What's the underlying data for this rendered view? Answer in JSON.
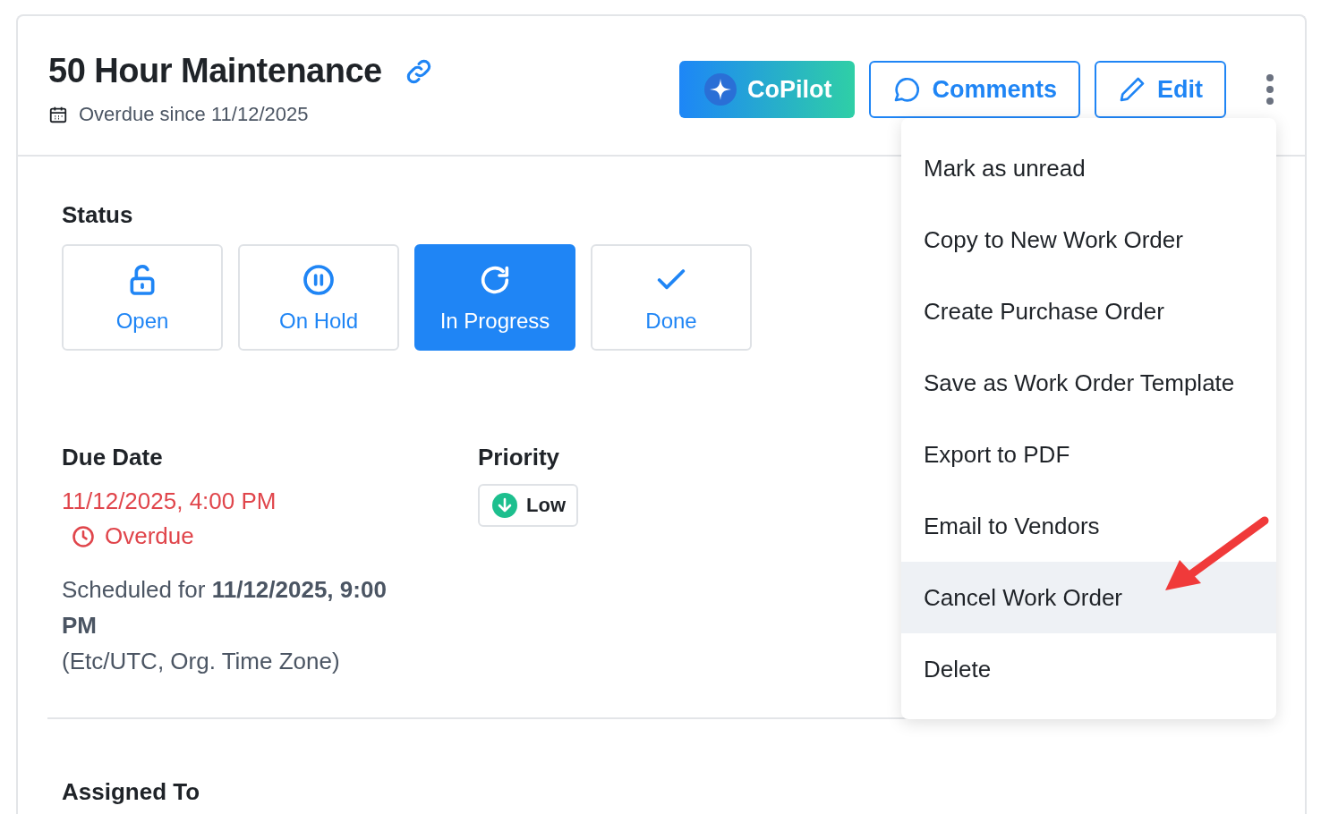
{
  "header": {
    "title": "50 Hour Maintenance",
    "subtitle": "Overdue since 11/12/2025",
    "buttons": [
      {
        "label": "CoPilot",
        "kind": "copilot"
      },
      {
        "label": "Comments",
        "kind": "comments"
      },
      {
        "label": "Edit",
        "kind": "edit"
      }
    ]
  },
  "status": {
    "label": "Status",
    "options": [
      {
        "label": "Open",
        "kind": "open",
        "selected": false
      },
      {
        "label": "On Hold",
        "kind": "hold",
        "selected": false
      },
      {
        "label": "In Progress",
        "kind": "progress",
        "selected": true
      },
      {
        "label": "Done",
        "kind": "done",
        "selected": false
      }
    ]
  },
  "due_date": {
    "label": "Due Date",
    "value": "11/12/2025, 4:00 PM",
    "overdue": "Overdue",
    "scheduled": "Scheduled for **11/12/2025, 9:00 PM**",
    "timezone": "(Etc/UTC, Org. Time Zone)"
  },
  "priority": {
    "label": "Priority",
    "value": "Low",
    "kind": "low"
  },
  "menu": [
    {
      "label": "Mark as unread",
      "selected": false
    },
    {
      "label": "Copy to New Work Order",
      "selected": false
    },
    {
      "label": "Create Purchase Order",
      "selected": false
    },
    {
      "label": "Save as Work Order Template",
      "selected": false
    },
    {
      "label": "Export to PDF",
      "selected": false
    },
    {
      "label": "Email to Vendors",
      "selected": false
    },
    {
      "label": "Cancel Work Order",
      "selected": true
    },
    {
      "label": "Delete",
      "selected": false
    }
  ],
  "assigned": {
    "label": "Assigned To"
  }
}
